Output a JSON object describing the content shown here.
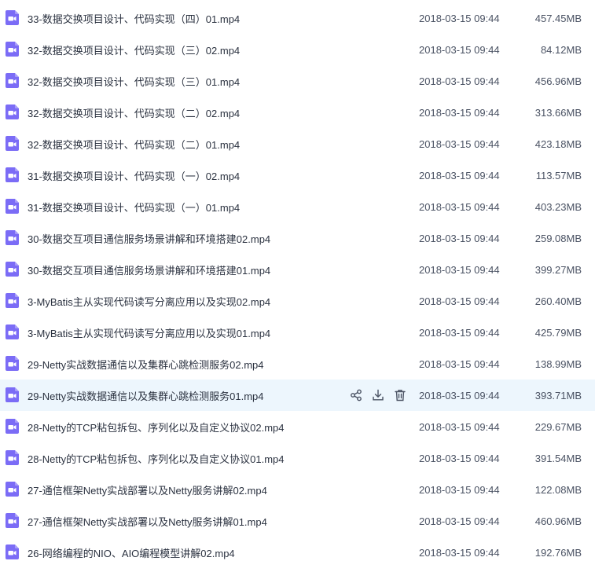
{
  "accent_color": "#7b6cf6",
  "hover_color": "#edf6fd",
  "hover_row_actions": [
    "share-icon",
    "download-icon",
    "trash-icon"
  ],
  "files": [
    {
      "name": "33-数据交换项目设计、代码实现（四）01.mp4",
      "date": "2018-03-15 09:44",
      "size": "457.45MB"
    },
    {
      "name": "32-数据交换项目设计、代码实现（三）02.mp4",
      "date": "2018-03-15 09:44",
      "size": "84.12MB"
    },
    {
      "name": "32-数据交换项目设计、代码实现（三）01.mp4",
      "date": "2018-03-15 09:44",
      "size": "456.96MB"
    },
    {
      "name": "32-数据交换项目设计、代码实现（二）02.mp4",
      "date": "2018-03-15 09:44",
      "size": "313.66MB"
    },
    {
      "name": "32-数据交换项目设计、代码实现（二）01.mp4",
      "date": "2018-03-15 09:44",
      "size": "423.18MB"
    },
    {
      "name": "31-数据交换项目设计、代码实现（一）02.mp4",
      "date": "2018-03-15 09:44",
      "size": "113.57MB"
    },
    {
      "name": "31-数据交换项目设计、代码实现（一）01.mp4",
      "date": "2018-03-15 09:44",
      "size": "403.23MB"
    },
    {
      "name": "30-数据交互项目通信服务场景讲解和环境搭建02.mp4",
      "date": "2018-03-15 09:44",
      "size": "259.08MB"
    },
    {
      "name": "30-数据交互项目通信服务场景讲解和环境搭建01.mp4",
      "date": "2018-03-15 09:44",
      "size": "399.27MB"
    },
    {
      "name": "3-MyBatis主从实现代码读写分离应用以及实现02.mp4",
      "date": "2018-03-15 09:44",
      "size": "260.40MB"
    },
    {
      "name": "3-MyBatis主从实现代码读写分离应用以及实现01.mp4",
      "date": "2018-03-15 09:44",
      "size": "425.79MB"
    },
    {
      "name": "29-Netty实战数据通信以及集群心跳检测服务02.mp4",
      "date": "2018-03-15 09:44",
      "size": "138.99MB"
    },
    {
      "name": "29-Netty实战数据通信以及集群心跳检测服务01.mp4",
      "date": "2018-03-15 09:44",
      "size": "393.71MB",
      "hovered": true
    },
    {
      "name": "28-Netty的TCP粘包拆包、序列化以及自定义协议02.mp4",
      "date": "2018-03-15 09:44",
      "size": "229.67MB"
    },
    {
      "name": "28-Netty的TCP粘包拆包、序列化以及自定义协议01.mp4",
      "date": "2018-03-15 09:44",
      "size": "391.54MB"
    },
    {
      "name": "27-通信框架Netty实战部署以及Netty服务讲解02.mp4",
      "date": "2018-03-15 09:44",
      "size": "122.08MB"
    },
    {
      "name": "27-通信框架Netty实战部署以及Netty服务讲解01.mp4",
      "date": "2018-03-15 09:44",
      "size": "460.96MB"
    },
    {
      "name": "26-网络编程的NIO、AIO编程模型讲解02.mp4",
      "date": "2018-03-15 09:44",
      "size": "192.76MB"
    }
  ]
}
